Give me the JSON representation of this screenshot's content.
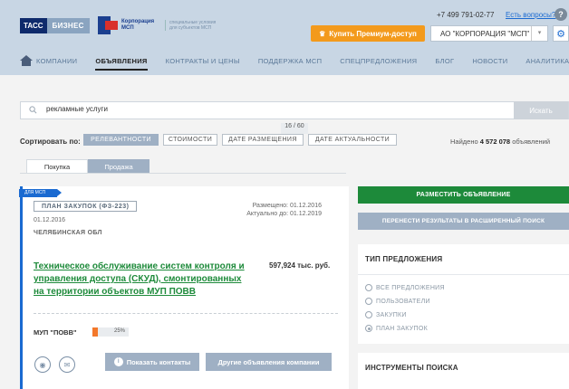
{
  "header": {
    "logo_tass": "ТАСС",
    "logo_biz": "БИЗНЕС",
    "msp_name": "Корпорация МСП",
    "msp_sub": "специальные условия для субъектов МСП",
    "phone": "+7 499 791-02-77",
    "question_link": "Есть вопросы?",
    "help_icon": "?",
    "premium_button": "Купить Премиум-доступ",
    "org_select": "АО \"КОРПОРАЦИЯ \"МСП\"",
    "gear_icon": "⚙"
  },
  "nav": {
    "items": [
      {
        "label": "КОМПАНИИ",
        "active": false
      },
      {
        "label": "ОБЪЯВЛЕНИЯ",
        "active": true
      },
      {
        "label": "КОНТРАКТЫ И ЦЕНЫ",
        "active": false
      },
      {
        "label": "ПОДДЕРЖКА МСП",
        "active": false
      },
      {
        "label": "СПЕЦПРЕДЛОЖЕНИЯ",
        "active": false
      },
      {
        "label": "БЛОГ",
        "active": false
      },
      {
        "label": "НОВОСТИ",
        "active": false
      },
      {
        "label": "АНАЛИТИКА",
        "active": false
      }
    ]
  },
  "search": {
    "value": "рекламные услуги",
    "button": "Искать"
  },
  "sort": {
    "label": "Сортировать по:",
    "pager": "16 / 60",
    "options": [
      "РЕЛЕВАНТНОСТИ",
      "СТОИМОСТИ",
      "ДАТЕ РАЗМЕЩЕНИЯ",
      "ДАТЕ АКТУАЛЬНОСТИ"
    ],
    "found_prefix": "Найдено ",
    "found_count": "4 572 078",
    "found_suffix": " объявлений"
  },
  "tabs": {
    "purchase": "Покупка",
    "sale": "Продажа"
  },
  "card": {
    "badge": "ДЛЯ МСП",
    "plan_badge": "ПЛАН ЗАКУПОК (ФЗ-223)",
    "date": "01.12.2016",
    "region": "ЧЕЛЯБИНСКАЯ ОБЛ",
    "placed": "Размещено: 01.12.2016",
    "actual": "Актуально до: 01.12.2019",
    "title": "Техническое обслуживание систем контроля и управления доступа (СКУД), смонтированных на территории объектов МУП ПОВВ",
    "price": "597,924 тыс. руб.",
    "customer": "МУП \"ПОВВ\"",
    "progress_percent": 25,
    "progress_label": "25%",
    "eye_icon": "◉",
    "mail_icon": "✉",
    "info_icon": "i",
    "contacts_button": "Показать контакты",
    "other_button": "Другие объявления компании"
  },
  "sidebar": {
    "post_button": "РАЗМЕСТИТЬ ОБЪЯВЛЕНИЕ",
    "transfer_button": "ПЕРЕНЕСТИ РЕЗУЛЬТАТЫ В РАСШИРЕННЫЙ ПОИСК",
    "offer_type_title": "ТИП ПРЕДЛОЖЕНИЯ",
    "offer_types": [
      {
        "label": "ВСЕ ПРЕДЛОЖЕНИЯ",
        "checked": false
      },
      {
        "label": "ПОЛЬЗОВАТЕЛИ",
        "checked": false
      },
      {
        "label": "ЗАКУПКИ",
        "checked": false
      },
      {
        "label": "ПЛАН ЗАКУПОК",
        "checked": true
      }
    ],
    "tools_title": "ИНСТРУМЕНТЫ ПОИСКА"
  },
  "colors": {
    "accent_green": "#1d8a3a",
    "accent_orange": "#f39a1c",
    "accent_blue": "#1a6ad1",
    "muted_button": "#9fb0c4"
  }
}
